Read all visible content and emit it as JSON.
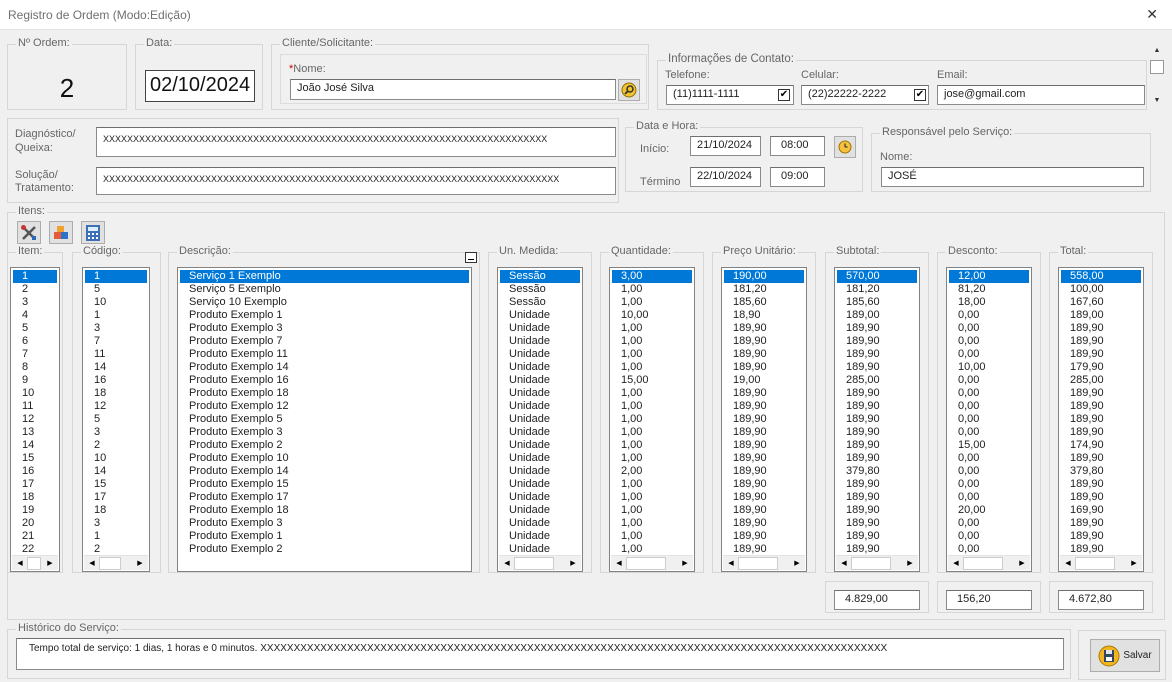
{
  "window": {
    "title": "Registro de Ordem (Modo:Edição)",
    "close": "✕"
  },
  "order": {
    "label": "Nº Ordem:",
    "value": "2"
  },
  "date": {
    "label": "Data:",
    "value": "02/10/2024"
  },
  "client": {
    "group_label": "Cliente/Solicitante:",
    "required_mark": "*",
    "name_label": "Nome:",
    "name_value": "João José Silva"
  },
  "contact": {
    "group_label": "Informações de Contato:",
    "phone_label": "Telefone:",
    "phone_value": "(11)1111-1111",
    "cell_label": "Celular:",
    "cell_value": "(22)22222-2222",
    "email_label": "Email:",
    "email_value": "jose@gmail.com"
  },
  "diagnosis": {
    "label1": "Diagnóstico/",
    "label2": "Queixa:",
    "value": "XXXXXXXXXXXXXXXXXXXXXXXXXXXXXXXXXXXXXXXXXXXXXXXXXXXXXXXXXXXXXXXXXXXXXXXXXX"
  },
  "solution": {
    "label1": "Solução/",
    "label2": "Tratamento:",
    "value": "XXXXXXXXXXXXXXXXXXXXXXXXXXXXXXXXXXXXXXXXXXXXXXXXXXXXXXXXXXXXXXXXXXXXXXXXXXXX"
  },
  "datetime": {
    "group_label": "Data e Hora:",
    "start_label": "Início:",
    "start_date": "21/10/2024",
    "start_time": "08:00",
    "end_label": "Término",
    "end_date": "22/10/2024",
    "end_time": "09:00"
  },
  "responsible": {
    "group_label": "Responsável pelo Serviço:",
    "name_label": "Nome:",
    "name_value": "JOSÉ"
  },
  "items": {
    "group_label": "Itens:",
    "headers": {
      "item": "Item:",
      "code": "Código:",
      "desc": "Descrição:",
      "unit": "Un. Medida:",
      "qty": "Quantidade:",
      "price": "Preço Unitário:",
      "subtotal": "Subtotal:",
      "discount": "Desconto:",
      "total": "Total:"
    },
    "col_item": [
      "1",
      "2",
      "3",
      "4",
      "5",
      "6",
      "7",
      "8",
      "9",
      "10",
      "11",
      "12",
      "13",
      "14",
      "15",
      "16",
      "17",
      "18",
      "19",
      "20",
      "21",
      "22"
    ],
    "col_code": [
      "1",
      "5",
      "10",
      "1",
      "3",
      "7",
      "11",
      "14",
      "16",
      "18",
      "12",
      "5",
      "3",
      "2",
      "10",
      "14",
      "15",
      "17",
      "18",
      "3",
      "1",
      "2"
    ],
    "col_desc": [
      "Serviço 1 Exemplo",
      "Serviço 5 Exemplo",
      "Serviço 10 Exemplo",
      "Produto Exemplo 1",
      "Produto Exemplo 3",
      "Produto Exemplo 7",
      "Produto Exemplo 11",
      "Produto Exemplo 14",
      "Produto Exemplo 16",
      "Produto Exemplo 18",
      "Produto Exemplo 12",
      "Produto Exemplo 5",
      "Produto Exemplo 3",
      "Produto Exemplo 2",
      "Produto Exemplo 10",
      "Produto Exemplo 14",
      "Produto Exemplo 15",
      "Produto Exemplo 17",
      "Produto Exemplo 18",
      "Produto Exemplo 3",
      "Produto Exemplo 1",
      "Produto Exemplo 2"
    ],
    "col_unit": [
      "Sessão",
      "Sessão",
      "Sessão",
      "Unidade",
      "Unidade",
      "Unidade",
      "Unidade",
      "Unidade",
      "Unidade",
      "Unidade",
      "Unidade",
      "Unidade",
      "Unidade",
      "Unidade",
      "Unidade",
      "Unidade",
      "Unidade",
      "Unidade",
      "Unidade",
      "Unidade",
      "Unidade",
      "Unidade"
    ],
    "col_qty": [
      "3,00",
      "1,00",
      "1,00",
      "10,00",
      "1,00",
      "1,00",
      "1,00",
      "1,00",
      "15,00",
      "1,00",
      "1,00",
      "1,00",
      "1,00",
      "1,00",
      "1,00",
      "2,00",
      "1,00",
      "1,00",
      "1,00",
      "1,00",
      "1,00",
      "1,00"
    ],
    "col_price": [
      "190,00",
      "181,20",
      "185,60",
      "18,90",
      "189,90",
      "189,90",
      "189,90",
      "189,90",
      "19,00",
      "189,90",
      "189,90",
      "189,90",
      "189,90",
      "189,90",
      "189,90",
      "189,90",
      "189,90",
      "189,90",
      "189,90",
      "189,90",
      "189,90",
      "189,90"
    ],
    "col_subtotal": [
      "570,00",
      "181,20",
      "185,60",
      "189,00",
      "189,90",
      "189,90",
      "189,90",
      "189,90",
      "285,00",
      "189,90",
      "189,90",
      "189,90",
      "189,90",
      "189,90",
      "189,90",
      "379,80",
      "189,90",
      "189,90",
      "189,90",
      "189,90",
      "189,90",
      "189,90"
    ],
    "col_discount": [
      "12,00",
      "81,20",
      "18,00",
      "0,00",
      "0,00",
      "0,00",
      "0,00",
      "10,00",
      "0,00",
      "0,00",
      "0,00",
      "0,00",
      "0,00",
      "15,00",
      "0,00",
      "0,00",
      "0,00",
      "0,00",
      "20,00",
      "0,00",
      "0,00",
      "0,00"
    ],
    "col_total": [
      "558,00",
      "100,00",
      "167,60",
      "189,00",
      "189,90",
      "189,90",
      "189,90",
      "179,90",
      "285,00",
      "189,90",
      "189,90",
      "189,90",
      "189,90",
      "174,90",
      "189,90",
      "379,80",
      "189,90",
      "189,90",
      "169,90",
      "189,90",
      "189,90",
      "189,90"
    ],
    "sum_subtotal": "4.829,00",
    "sum_discount": "156,20",
    "sum_total": "4.672,80"
  },
  "history": {
    "group_label": "Histórico do Serviço:",
    "value": "Tempo total de serviço: 1 dias, 1 horas e 0 minutos. XXXXXXXXXXXXXXXXXXXXXXXXXXXXXXXXXXXXXXXXXXXXXXXXXXXXXXXXXXXXXXXXXXXXXXXXXXXXXXXXXXXXXXXXXXXXXX"
  },
  "save_label": "Salvar"
}
